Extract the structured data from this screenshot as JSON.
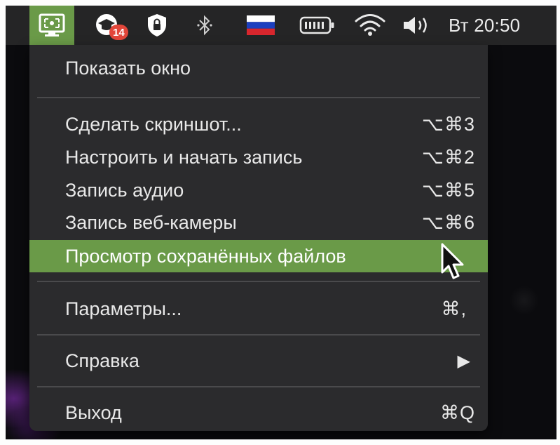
{
  "menubar": {
    "clock": "Вт 20:50",
    "badge_count": "14",
    "icons": [
      "screen-recorder-icon",
      "graduation-cap-icon",
      "shield-lock-icon",
      "bluetooth-icon",
      "russian-flag-icon",
      "battery-icon",
      "wifi-icon",
      "volume-icon"
    ]
  },
  "menu": {
    "items": [
      {
        "label": "Показать окно",
        "shortcut": ""
      },
      {
        "label": "Сделать скриншот...",
        "shortcut": "⌥⌘3"
      },
      {
        "label": "Настроить и начать запись",
        "shortcut": "⌥⌘2"
      },
      {
        "label": "Запись аудио",
        "shortcut": "⌥⌘5"
      },
      {
        "label": "Запись веб-камеры",
        "shortcut": "⌥⌘6"
      },
      {
        "label": "Просмотр сохранённых файлов",
        "shortcut": ""
      },
      {
        "label": "Параметры...",
        "shortcut": "⌘,"
      },
      {
        "label": "Справка",
        "shortcut": "▶"
      },
      {
        "label": "Выход",
        "shortcut": "⌘Q"
      }
    ],
    "highlighted_index": 5
  },
  "colors": {
    "accent": "#6a9a48",
    "menu_bg": "#2b2b2d",
    "menubar_bg": "#252526",
    "badge": "#e2463a",
    "flag_white": "#ffffff",
    "flag_blue": "#1c3fbf",
    "flag_red": "#d8262d"
  }
}
